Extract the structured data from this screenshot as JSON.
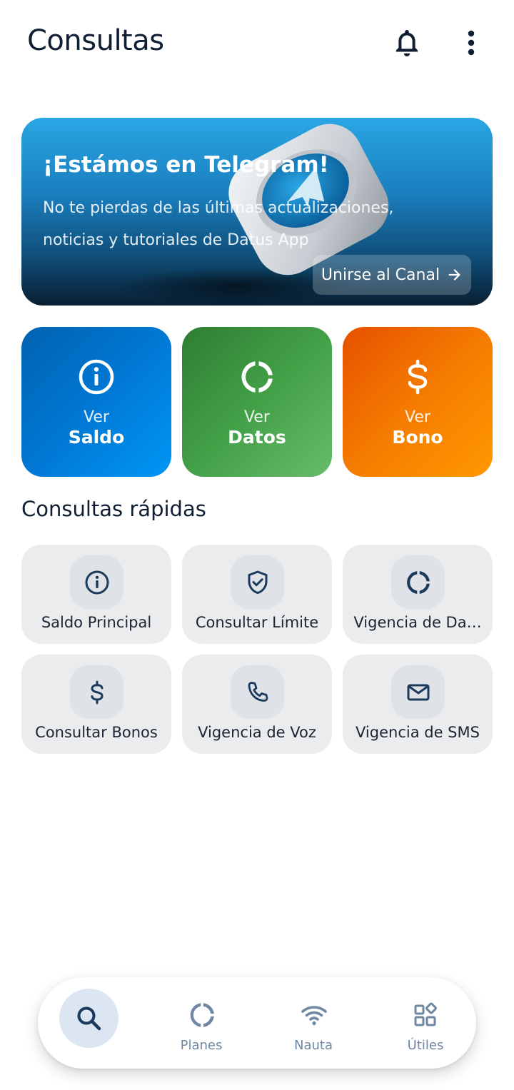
{
  "appbar": {
    "title": "Consultas",
    "notifications_icon": "bell-icon",
    "menu_icon": "more-vertical-icon"
  },
  "banner": {
    "title": "¡Estámos en Telegram!",
    "text": "No te pierdas de las últimas actualizaciones, noticias y tutoriales de Datus App",
    "button_label": "Unirse al Canal",
    "button_icon": "arrow-right-icon",
    "art": "telegram-logo-3d"
  },
  "tiles": [
    {
      "sub": "Ver",
      "main": "Saldo",
      "icon": "info-icon",
      "color_start": "#0062b0",
      "color_end": "#0096f5"
    },
    {
      "sub": "Ver",
      "main": "Datos",
      "icon": "data-ring-icon",
      "color_start": "#2e7d32",
      "color_end": "#66bb6a"
    },
    {
      "sub": "Ver",
      "main": "Bono",
      "icon": "dollar-icon",
      "color_start": "#e65100",
      "color_end": "#ff9800"
    }
  ],
  "quick": {
    "title": "Consultas rápidas",
    "items": [
      {
        "label": "Saldo Principal",
        "icon": "info-icon"
      },
      {
        "label": "Consultar Límite",
        "icon": "shield-check-icon"
      },
      {
        "label": "Vigencia de Da…",
        "icon": "data-ring-icon"
      },
      {
        "label": "Consultar Bonos",
        "icon": "dollar-icon"
      },
      {
        "label": "Vigencia de Voz",
        "icon": "phone-icon"
      },
      {
        "label": "Vigencia de SMS",
        "icon": "mail-icon"
      }
    ]
  },
  "nav": {
    "active": "search",
    "items": [
      {
        "label": "",
        "icon": "search-icon"
      },
      {
        "label": "Planes",
        "icon": "data-ring-icon"
      },
      {
        "label": "Nauta",
        "icon": "wifi-icon"
      },
      {
        "label": "Útiles",
        "icon": "widgets-icon"
      }
    ]
  },
  "colors": {
    "text_primary": "#0f1e33",
    "icon_dark": "#1b3a5c",
    "card_bg": "#ebeced",
    "nav_label": "#6f87a3",
    "nav_active_bg": "#dbe6f2"
  }
}
